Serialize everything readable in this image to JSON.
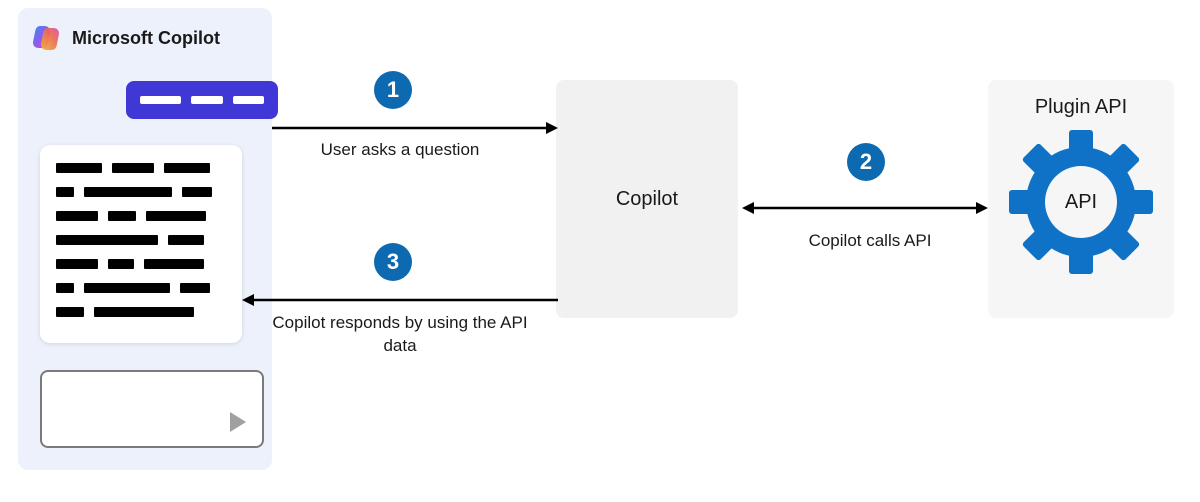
{
  "panel": {
    "title": "Microsoft Copilot"
  },
  "center": {
    "label": "Copilot"
  },
  "api": {
    "title": "Plugin API",
    "center_text": "API"
  },
  "steps": {
    "s1": {
      "num": "1",
      "label": "User asks a question"
    },
    "s2": {
      "num": "2",
      "label": "Copilot calls API"
    },
    "s3": {
      "num": "3",
      "label": "Copilot responds by using the API data"
    }
  },
  "colors": {
    "badge": "#0e6ab0",
    "user_bubble": "#4038d6",
    "panel_bg": "#ecf1fb",
    "gear": "#1072c6"
  }
}
